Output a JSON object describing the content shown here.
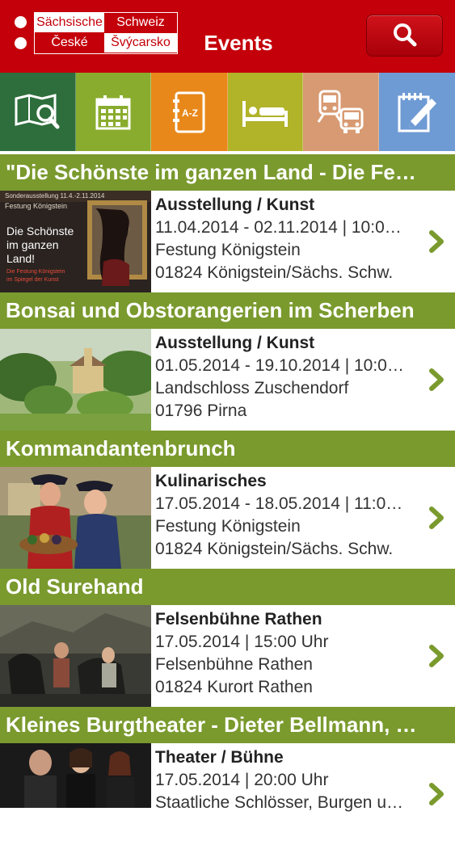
{
  "header": {
    "logo": {
      "line1_left": "Sächsische",
      "line1_right": "Schweiz",
      "line2_left": "České",
      "line2_right": "Švýcarsko"
    },
    "title": "Events",
    "search_icon": "search-icon"
  },
  "nav_tiles": [
    {
      "icon": "map-search-icon",
      "color": "#2e6e3c"
    },
    {
      "icon": "calendar-icon",
      "color": "#8aac2e"
    },
    {
      "icon": "a-z-index-icon",
      "color": "#e8881b"
    },
    {
      "icon": "bed-icon",
      "color": "#b1b329"
    },
    {
      "icon": "train-bus-icon",
      "color": "#d89a72"
    },
    {
      "icon": "notepad-pencil-icon",
      "color": "#6f9bd4"
    }
  ],
  "colors": {
    "header_red": "#c4000a",
    "title_green": "#7a9a2e",
    "chevron_green": "#7a9a2e"
  },
  "events": [
    {
      "title": "\"Die Schönste im ganzen Land - Die Fe…",
      "category": "Ausstellung / Kunst",
      "date": "11.04.2014 - 02.11.2014 | 10:0…",
      "location": "Festung Königstein",
      "address": "01824 Königstein/Sächs. Schw.",
      "poster": {
        "top": "Festung Königstein",
        "main": "Die Schönste im ganzen Land!",
        "sub": "Die Festung Königstein im Spiegel der Kunst"
      }
    },
    {
      "title": "Bonsai und Obstorangerien im Scherben",
      "category": "Ausstellung / Kunst",
      "date": "01.05.2014 - 19.10.2014 | 10:0…",
      "location": "Landschloss Zuschendorf",
      "address": "01796 Pirna"
    },
    {
      "title": "Kommandantenbrunch",
      "category": "Kulinarisches",
      "date": "17.05.2014 - 18.05.2014 | 11:0…",
      "location": "Festung Königstein",
      "address": "01824 Königstein/Sächs. Schw."
    },
    {
      "title": "Old Surehand",
      "category": "Felsenbühne Rathen",
      "date": "17.05.2014 | 15:00 Uhr",
      "location": "Felsenbühne Rathen",
      "address": "01824 Kurort Rathen"
    },
    {
      "title": "Kleines Burgtheater - Dieter Bellmann, …",
      "category": "Theater / Bühne",
      "date": "17.05.2014 | 20:00 Uhr",
      "location": "Staatliche Schlösser, Burgen u…",
      "address": ""
    }
  ]
}
